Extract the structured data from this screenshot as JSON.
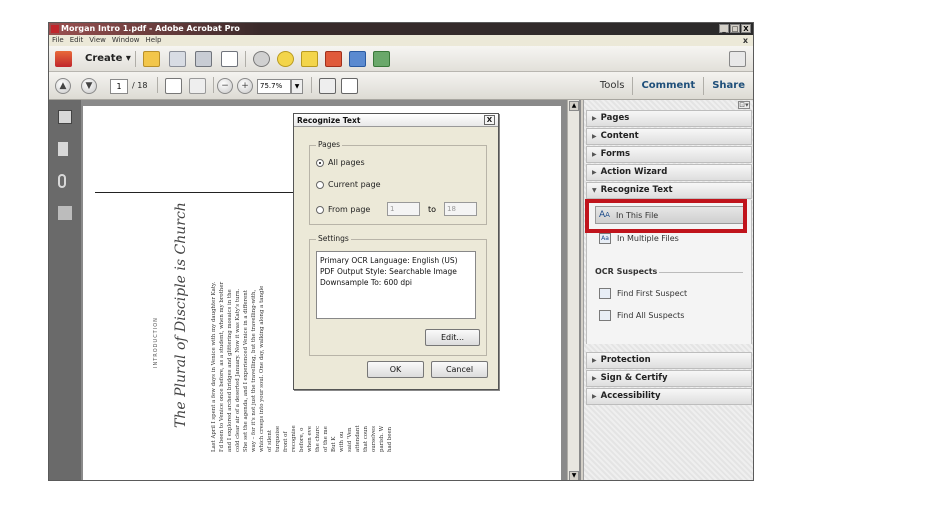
{
  "window": {
    "title": "Morgan Intro 1.pdf - Adobe Acrobat Pro",
    "min": "_",
    "max": "□",
    "close": "X"
  },
  "menu": {
    "items": [
      "File",
      "Edit",
      "View",
      "Window",
      "Help"
    ],
    "close": "x"
  },
  "toolbar": {
    "create_label": "Create",
    "dropdown_caret": "▾"
  },
  "nav": {
    "page_current": "1",
    "page_total": "/ 18",
    "zoom": "75.7%"
  },
  "panel_tabs": {
    "tools": "Tools",
    "comment": "Comment",
    "share": "Share"
  },
  "document": {
    "intro": "INTRODUCTION",
    "title": "The Plural of Disciple is Church",
    "body_lines": [
      "Last April I spent a few days in Venice with my daughter Katy.",
      "I'd been to Venice once before, as a student, when my brother",
      "and I explored arched bridges and glittering mosaics in the",
      "cold clear air of a deserted January. Now it was Katy's turn.",
      "She set the agenda, and I experienced Venice in a different",
      "way – for it's not just the travelling, but the travelling-with,",
      "which creeps into your soul. One day, walking along a tangle"
    ],
    "fragments": [
      "of silent",
      "turquoise",
      "front of",
      "recognise",
      "before, o",
      "when eve",
      "the churc",
      "of the me",
      "But K",
      "with ou",
      "said 'Ven",
      "attendant",
      "that coun",
      "ourselves",
      "parish. W",
      "had been"
    ]
  },
  "dialog": {
    "title": "Recognize Text",
    "close": "X",
    "pages_label": "Pages",
    "all_pages": "All pages",
    "current_page": "Current page",
    "from_page": "From page",
    "from_value": "1",
    "to_label": "to",
    "to_value": "18",
    "settings_label": "Settings",
    "settings_lines": [
      "Primary OCR Language: English (US)",
      "PDF Output Style: Searchable Image",
      "Downsample To: 600 dpi"
    ],
    "edit_button": "Edit...",
    "ok_button": "OK",
    "cancel_button": "Cancel"
  },
  "right_panel": {
    "options": "⊡▾",
    "sections_top": [
      "Pages",
      "Content",
      "Forms",
      "Action Wizard"
    ],
    "recognize_header": "Recognize Text",
    "in_this_file": "In This File",
    "in_multiple_files": "In Multiple Files",
    "ocr_suspects": "OCR Suspects",
    "find_first": "Find First Suspect",
    "find_all": "Find All Suspects",
    "sections_bottom": [
      "Protection",
      "Sign & Certify",
      "Accessibility"
    ]
  },
  "colors": {
    "highlight": "#c0141c",
    "active_tab": "#1f4f7a"
  }
}
